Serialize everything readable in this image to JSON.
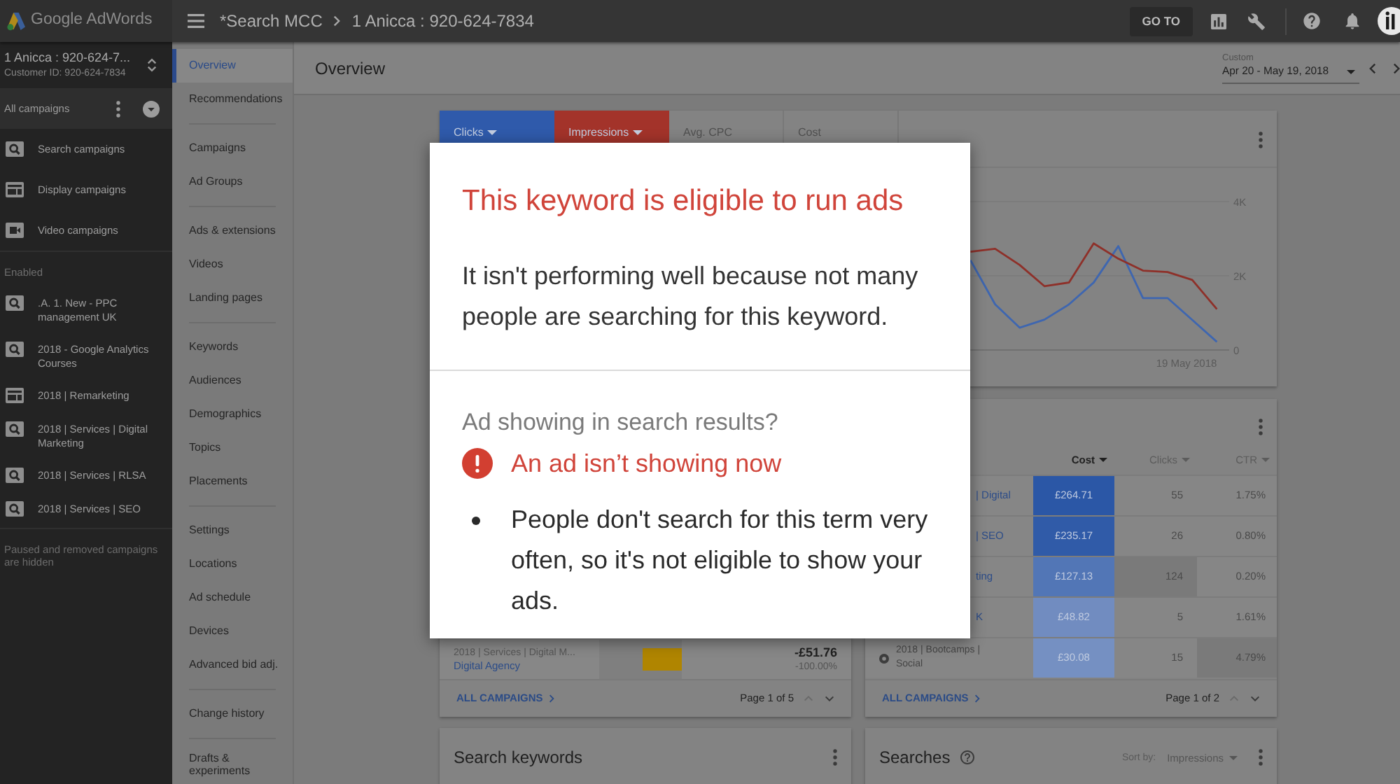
{
  "top_bar": {
    "product_name": "Google AdWords",
    "breadcrumb": [
      "*Search MCC",
      "1 Anicca : 920-624-7834"
    ],
    "go_to_button": "GO TO"
  },
  "account": {
    "name": "1 Anicca : 920-624-7...",
    "customer_id": "Customer ID: 920-624-7834"
  },
  "campaign_filter": "All campaigns",
  "campaign_types": [
    {
      "kind": "search",
      "label": "Search campaigns"
    },
    {
      "kind": "display",
      "label": "Display campaigns"
    },
    {
      "kind": "video",
      "label": "Video campaigns"
    }
  ],
  "enabled_campaigns": {
    "heading": "Enabled",
    "items": [
      {
        "kind": "search",
        "label": ".A. 1. New - PPC management UK"
      },
      {
        "kind": "search",
        "label": "2018 - Google Analytics Courses"
      },
      {
        "kind": "display",
        "label": "2018 | Remarketing"
      },
      {
        "kind": "search",
        "label": "2018 | Services | Digital Marketing"
      },
      {
        "kind": "search",
        "label": "2018 | Services | RLSA"
      },
      {
        "kind": "search",
        "label": "2018 | Services | SEO"
      }
    ]
  },
  "sidebar_note": "Paused and removed campaigns are hidden",
  "nav_groups": [
    [
      {
        "label": "Overview",
        "selected": true
      },
      {
        "label": "Recommendations",
        "selected": false
      }
    ],
    [
      {
        "label": "Campaigns",
        "selected": false
      },
      {
        "label": "Ad Groups",
        "selected": false
      }
    ],
    [
      {
        "label": "Ads & extensions",
        "selected": false
      },
      {
        "label": "Videos",
        "selected": false
      },
      {
        "label": "Landing pages",
        "selected": false
      }
    ],
    [
      {
        "label": "Keywords",
        "selected": false
      },
      {
        "label": "Audiences",
        "selected": false
      },
      {
        "label": "Demographics",
        "selected": false
      },
      {
        "label": "Topics",
        "selected": false
      },
      {
        "label": "Placements",
        "selected": false
      }
    ],
    [
      {
        "label": "Settings",
        "selected": false
      },
      {
        "label": "Locations",
        "selected": false
      },
      {
        "label": "Ad schedule",
        "selected": false
      },
      {
        "label": "Devices",
        "selected": false
      },
      {
        "label": "Advanced bid adj.",
        "selected": false
      }
    ],
    [
      {
        "label": "Change history",
        "selected": false
      }
    ],
    [
      {
        "label": "Drafts & experiments",
        "selected": false
      }
    ]
  ],
  "header": {
    "title": "Overview",
    "date_range_label": "Custom",
    "date_range": "Apr 20 - May 19, 2018"
  },
  "performance_card": {
    "metric_tabs": [
      {
        "label": "Clicks",
        "selected": true,
        "color": "#2f5aab"
      },
      {
        "label": "Impressions",
        "selected": true,
        "color": "#a3332a"
      },
      {
        "label": "Avg. CPC",
        "selected": false
      },
      {
        "label": "Cost",
        "selected": false
      }
    ],
    "chart_data": {
      "type": "line",
      "ylim": [
        0,
        4000
      ],
      "yticks": [
        {
          "value": 0,
          "label": "0"
        },
        {
          "value": 2000,
          "label": "2K"
        },
        {
          "value": 4000,
          "label": "4K"
        }
      ],
      "series": [
        {
          "color": "#3e66b0",
          "values": [
            null,
            null,
            null,
            null,
            null,
            null,
            null,
            null,
            null,
            null,
            null,
            null,
            null,
            null,
            null,
            null,
            null,
            null,
            null,
            2420,
            1230,
            600,
            820,
            1230,
            1820,
            2800,
            1400,
            1400,
            810,
            220
          ]
        },
        {
          "color": "#8e3029",
          "values": [
            null,
            null,
            null,
            null,
            null,
            null,
            null,
            null,
            null,
            null,
            null,
            null,
            null,
            null,
            null,
            null,
            null,
            null,
            null,
            2650,
            2730,
            2290,
            1720,
            1820,
            2870,
            2460,
            2140,
            2100,
            1890,
            1100
          ]
        }
      ]
    },
    "end_date_label": "19 May 2018"
  },
  "keyword_popup": {
    "title": "This keyword is eligible to run ads",
    "message": "It isn't performing well because not many people are searching for this keyword.",
    "status_question": "Ad showing in search results?",
    "status": "An ad isn’t showing now",
    "reasons": [
      "People don't search for this term very often, so it's not eligible to show your ads."
    ]
  },
  "campaigns_card": {
    "rows": [
      {
        "campaign": "2018 | Services | Digital M...",
        "ad_group": "Digital Agency",
        "level": 0.48,
        "change": "-£51.76",
        "change_percent": "-100.00%"
      }
    ],
    "footer_link": "ALL CAMPAIGNS",
    "pagination": "Page 1 of 5"
  },
  "cost_card": {
    "columns": [
      {
        "label": "Cost",
        "sorted": true
      },
      {
        "label": "Clicks",
        "sorted": false
      },
      {
        "label": "CTR",
        "sorted": false
      }
    ],
    "rows": [
      {
        "kind": "partial",
        "campaign": "| Digital",
        "cost": {
          "value": "£264.71",
          "color": "#2b57a6"
        },
        "clicks": {
          "value": "55",
          "highlighted": false
        },
        "ctr": {
          "value": "1.75%",
          "highlighted": false
        }
      },
      {
        "kind": "partial",
        "campaign": "| SEO",
        "cost": {
          "value": "£235.17",
          "color": "#305ba8"
        },
        "clicks": {
          "value": "26",
          "highlighted": false
        },
        "ctr": {
          "value": "0.80%",
          "highlighted": false
        }
      },
      {
        "kind": "partial",
        "campaign": "ting",
        "cost": {
          "value": "£127.13",
          "color": "#5276b6"
        },
        "clicks": {
          "value": "124",
          "highlighted": true
        },
        "ctr": {
          "value": "0.20%",
          "highlighted": false
        }
      },
      {
        "kind": "partial",
        "campaign": "K",
        "cost": {
          "value": "£48.82",
          "color": "#718cc0"
        },
        "clicks": {
          "value": "5",
          "highlighted": false
        },
        "ctr": {
          "value": "1.61%",
          "highlighted": false
        }
      },
      {
        "kind": "full",
        "campaign": "2018 | Bootcamps | Social",
        "cost": {
          "value": "£30.08",
          "color": "#7590c2"
        },
        "clicks": {
          "value": "15",
          "highlighted": false
        },
        "ctr": {
          "value": "4.79%",
          "highlighted": true
        }
      }
    ],
    "footer_link": "ALL CAMPAIGNS",
    "pagination": "Page 1 of 2"
  },
  "search_keywords_card": {
    "title": "Search keywords"
  },
  "searches_card": {
    "title": "Searches",
    "sort_label": "Sort by:",
    "sort_value": "Impressions"
  }
}
